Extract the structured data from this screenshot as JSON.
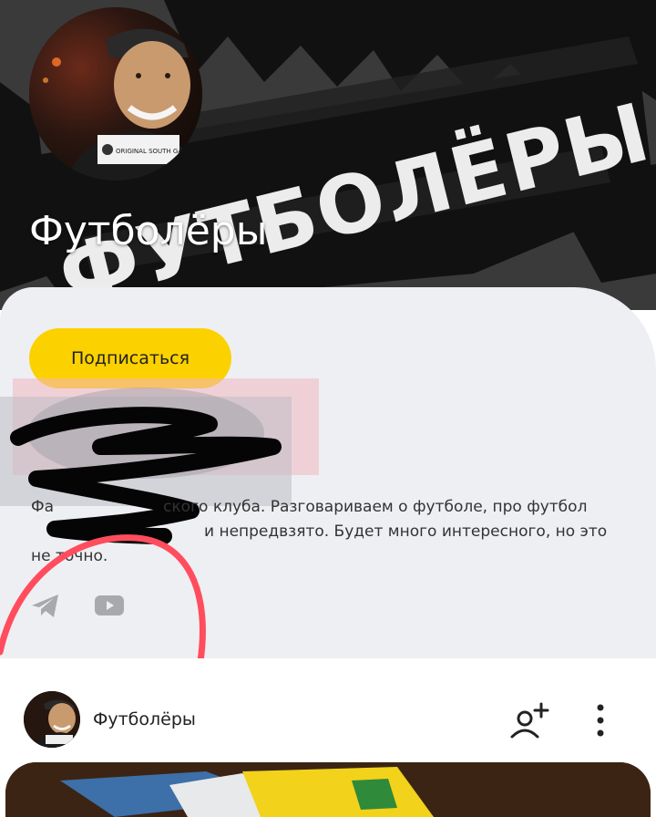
{
  "channel": {
    "title": "Футболёры",
    "banner_text": "ФУТБОЛЁРЫ",
    "avatar_shirt_text": "ORIGINAL SOUTH GANG"
  },
  "actions": {
    "subscribe_label": "Подписаться"
  },
  "description": {
    "line1": "Фа",
    "line1_tail": "ского клуба. Разговариваем о футболе, про футбол",
    "line2_tail": "и непредвзято. Будет много интересного, но это",
    "line3": "не точно."
  },
  "social": [
    {
      "name": "telegram-icon"
    },
    {
      "name": "youtube-icon"
    }
  ],
  "post": {
    "author": "Футболёры"
  },
  "colors": {
    "accent": "#fcd100",
    "card_bg": "#eeeff3",
    "annotation": "#ff3b4e"
  }
}
